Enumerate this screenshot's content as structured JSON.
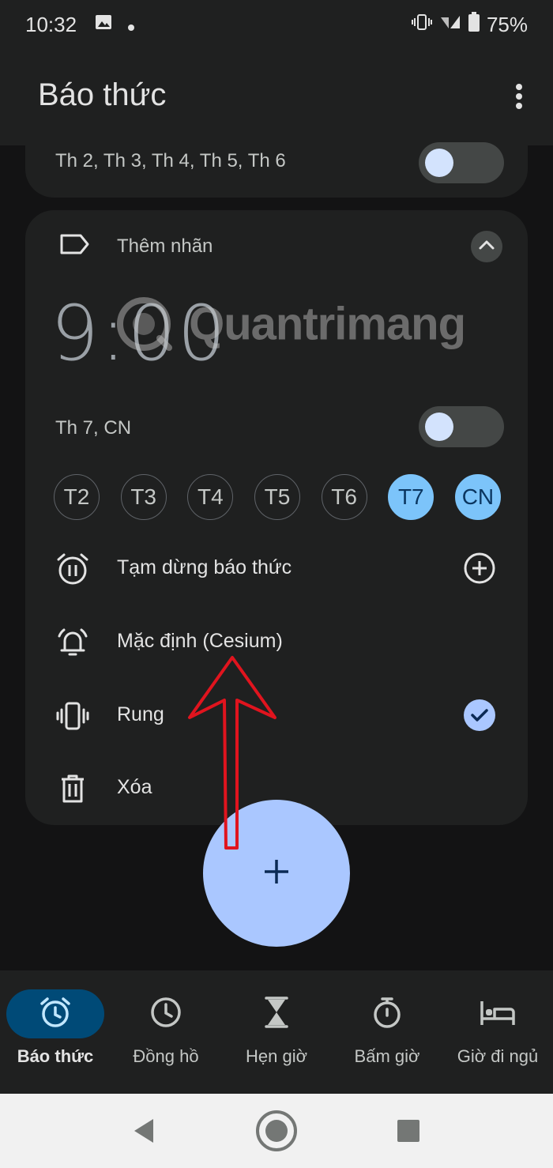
{
  "status_bar": {
    "time": "10:32",
    "battery": "75%"
  },
  "app_bar": {
    "title": "Báo thức"
  },
  "prev_alarm": {
    "days": "Th 2, Th 3, Th 4, Th 5, Th 6",
    "enabled": false
  },
  "alarm": {
    "label_placeholder": "Thêm nhãn",
    "time": "9:00",
    "day_summary": "Th 7, CN",
    "enabled": false,
    "days": [
      {
        "label": "T2",
        "selected": false
      },
      {
        "label": "T3",
        "selected": false
      },
      {
        "label": "T4",
        "selected": false
      },
      {
        "label": "T5",
        "selected": false
      },
      {
        "label": "T6",
        "selected": false
      },
      {
        "label": "T7",
        "selected": true
      },
      {
        "label": "CN",
        "selected": true
      }
    ],
    "options": {
      "pause": "Tạm dừng báo thức",
      "sound": "Mặc định (Cesium)",
      "vibrate": "Rung",
      "vibrate_checked": true,
      "delete": "Xóa"
    }
  },
  "watermark": "Quantrimang",
  "bottom_nav": {
    "items": [
      {
        "label": "Báo thức",
        "icon": "alarm-icon",
        "active": true
      },
      {
        "label": "Đồng hồ",
        "icon": "clock-icon",
        "active": false
      },
      {
        "label": "Hẹn giờ",
        "icon": "hourglass-icon",
        "active": false
      },
      {
        "label": "Bấm giờ",
        "icon": "stopwatch-icon",
        "active": false
      },
      {
        "label": "Giờ đi ngủ",
        "icon": "bed-icon",
        "active": false
      }
    ]
  },
  "colors": {
    "surface": "#1f2020",
    "background": "#131314",
    "accent": "#aac7ff",
    "day_selected": "#7cc4fa",
    "nav_active": "#004a77",
    "annotation": "#e0141e"
  }
}
